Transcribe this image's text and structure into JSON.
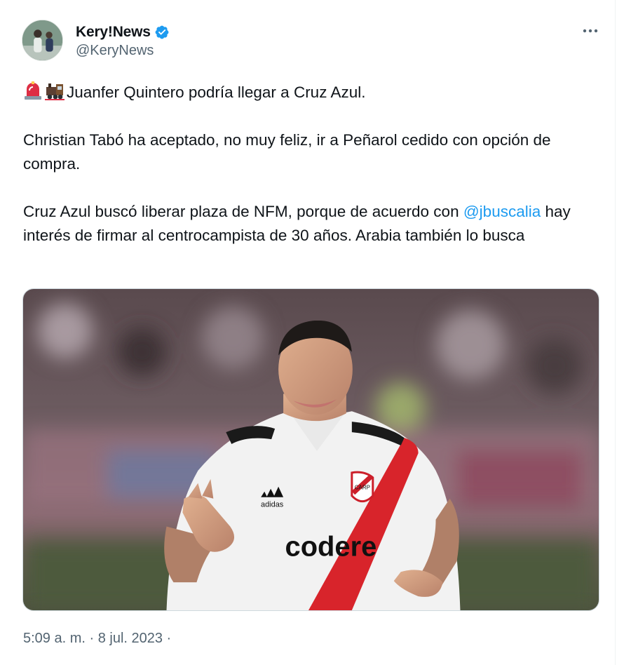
{
  "tweet": {
    "author": {
      "display_name": "Kery!News",
      "handle": "@KeryNews",
      "verified": true,
      "avatar_icon": "avatar-photo"
    },
    "more_icon": "more-icon",
    "line1": {
      "emojis": [
        "rotating-light-icon",
        "locomotive-icon"
      ],
      "text": "Juanfer Quintero podría llegar a Cruz Azul."
    },
    "paragraph2": "Christian Tabó ha aceptado, no muy feliz, ir a Peñarol cedido con opción de compra.",
    "paragraph3": {
      "before": "Cruz Azul buscó liberar plaza de NFM, porque de acuerdo con ",
      "mention": "@jbuscalia",
      "after": " hay interés de firmar al centrocampista de 30 años. Arabia también lo busca"
    },
    "media": {
      "kit_sponsor": "codere",
      "kit_brand": "adidas",
      "crest_text": "CARP"
    },
    "timestamp": "5:09 a. m. · 8 jul. 2023 ·"
  },
  "colors": {
    "accent": "#1d9bf0",
    "text": "#0f1419",
    "muted": "#536471",
    "jersey_red": "#d8242b"
  }
}
